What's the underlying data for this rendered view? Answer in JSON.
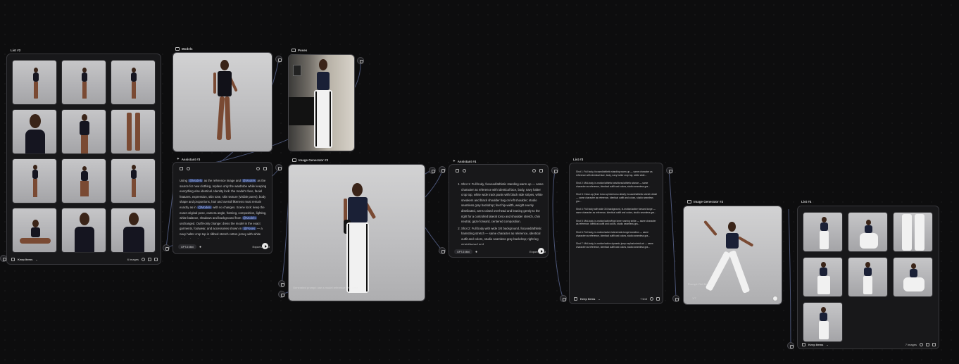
{
  "nodes": {
    "list2": {
      "title": "List #2",
      "footer_label": "Keep Items",
      "count": "6 images"
    },
    "models": {
      "title": "Models"
    },
    "poses": {
      "title": "Poses"
    },
    "assistant3": {
      "title": "Assistant #3",
      "prompt_segments": [
        "Using ",
        "@Models",
        " as the reference image and ",
        "@Models",
        " as the source for new clothing, replace only the wardrobe while keeping everything else identical. Identity lock: the model's face, facial features, expression, skin tone, skin texture (visible pores), body shape and proportions, hair and overall likeness must remain exactly as in ",
        "@Models",
        " with no changes. Scene lock: keep the exact original pose, camera angle, framing, composition, lighting, white balance, shadows and background from ",
        "@Models",
        " unchanged. Outfit-only change: dress the model in the exact garments, footwear, and accessories shown in ",
        "@Poses",
        " — a navy halter crop top in ribbed stretch cotton jersey with white piping along the neckline and"
      ],
      "model": "GPT-5 Mini",
      "export": "Export as text"
    },
    "imagegen3": {
      "title": "Image Generator #3",
      "watermark": "Generated prompt: use a model reference with outfit"
    },
    "assistant4": {
      "title": "Assistant #4",
      "items": [
        "Shot 1: Full body, focused/athletic standing warm-up — same character as reference with identical face, body, navy halter crop top, white wide track pants with black side stripes, white sneakers and black shoulder bag on left shoulder; studio seamless gray backdrop; feet hip-width, weight evenly distributed, arms raised overhead and leaning gently to the right for a controlled lateral torso and shoulder stretch, chin neutral, gaze forward, centered composition.",
        "Shot 2: Full body with wide 3/4 background, focused/athletic hamstring stretch — same character as reference, identical outfit and colors, studio seamless gray backdrop; right leg straightened and"
      ],
      "model": "GPT-5 Mini",
      "export": "Export as list"
    },
    "list3": {
      "title": "List #3",
      "entries": [
        "Shot 1: Full body, focused/athletic standing warm-up — same character as reference with identical face, body, navy halter crop top, white wide...",
        "Shot 2: Mid-body, in-motion/athletic twist/torso/athletic stance — same character as reference, identical outfit and colors, studio seamless gra...",
        "Shot 3: Close-up (from torso up/mid-torso detail), focused/athletic stretch detail — same character as reference, identical outfit and colors, studio seamless gra...",
        "Shot 4: Full body with wide 3/4 background, in-motion/active forward lunge — same character as reference, identical outfit and colors, studio seamless gra...",
        "Shot 5: Mid-body, in-motion/active/high knee running stride — same character as reference, identical outfit and colors, studio seamless gra...",
        "Shot 6: Full body, in-motion/active lateral side-lunge transition — same character as reference, identical outfit and colors, studio seamless gra...",
        "Shot 7: Mid-body, in-motion/active dynamic jump explosion/mid-air — same character as reference, identical outfit and colors, studio seamless gra..."
      ],
      "footer_label": "Keep Items",
      "count": "7 text"
    },
    "imagegen4": {
      "title": "Image Generator #4",
      "watermark": "Prompt: Ref-Motion",
      "badge": "1/7"
    },
    "list4": {
      "title": "List #4",
      "footer_label": "Keep Items",
      "count": "7 images"
    }
  },
  "colors": {
    "canvas": "#0d0d0e",
    "panel": "#18181a",
    "border": "#38383c",
    "mention": "#2c3a63",
    "wire": "#4b5577"
  }
}
